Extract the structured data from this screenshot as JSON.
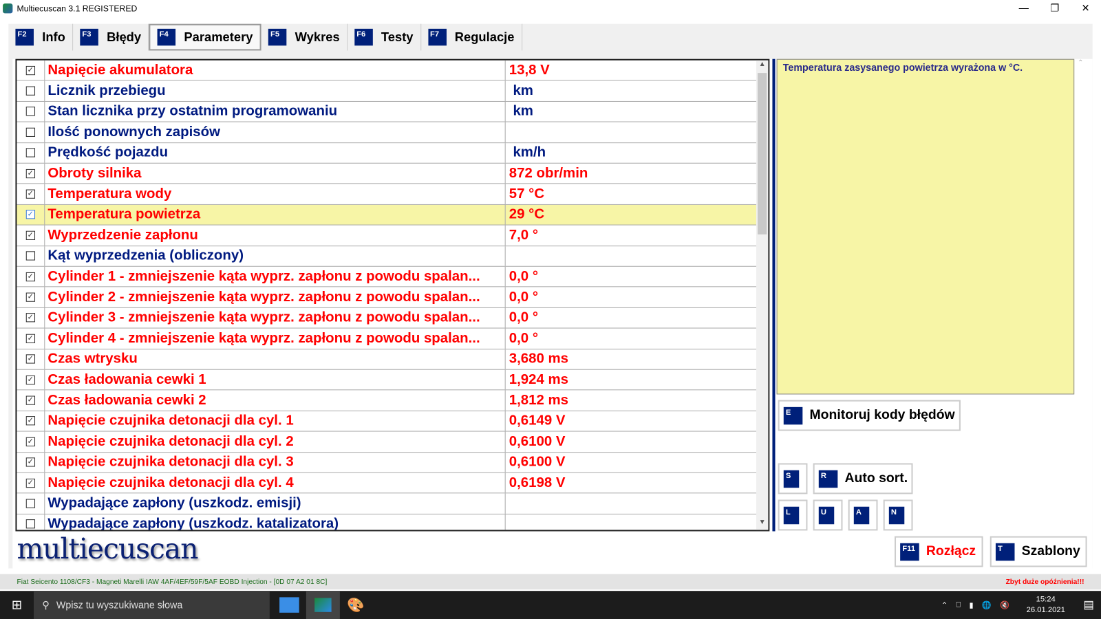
{
  "window": {
    "title": "Multiecuscan 3.1 REGISTERED"
  },
  "tabs": [
    {
      "key": "F2",
      "label": "Info"
    },
    {
      "key": "F3",
      "label": "Błędy"
    },
    {
      "key": "F4",
      "label": "Parametery"
    },
    {
      "key": "F5",
      "label": "Wykres"
    },
    {
      "key": "F6",
      "label": "Testy"
    },
    {
      "key": "F7",
      "label": "Regulacje"
    }
  ],
  "params": [
    {
      "checked": true,
      "name": "Napięcie akumulatora",
      "value": "13,8 V"
    },
    {
      "checked": false,
      "name": "Licznik przebiegu",
      "value": " km"
    },
    {
      "checked": false,
      "name": "Stan licznika przy ostatnim programowaniu",
      "value": " km"
    },
    {
      "checked": false,
      "name": "Ilość ponownych zapisów",
      "value": ""
    },
    {
      "checked": false,
      "name": "Prędkość pojazdu",
      "value": " km/h"
    },
    {
      "checked": true,
      "name": "Obroty silnika",
      "value": "872 obr/min"
    },
    {
      "checked": true,
      "name": "Temperatura wody",
      "value": "57 °C"
    },
    {
      "checked": true,
      "name": "Temperatura powietrza",
      "value": "29 °C",
      "selected": true
    },
    {
      "checked": true,
      "name": "Wyprzedzenie zapłonu",
      "value": "7,0 °"
    },
    {
      "checked": false,
      "name": "Kąt wyprzedzenia (obliczony)",
      "value": ""
    },
    {
      "checked": true,
      "name": "Cylinder 1 - zmniejszenie kąta wyprz. zapłonu z powodu spalan...",
      "value": "0,0 °"
    },
    {
      "checked": true,
      "name": "Cylinder 2 - zmniejszenie kąta wyprz. zapłonu z powodu spalan...",
      "value": "0,0 °"
    },
    {
      "checked": true,
      "name": "Cylinder 3 - zmniejszenie kąta wyprz. zapłonu z powodu spalan...",
      "value": "0,0 °"
    },
    {
      "checked": true,
      "name": "Cylinder 4 - zmniejszenie kąta wyprz. zapłonu z powodu spalan...",
      "value": "0,0 °"
    },
    {
      "checked": true,
      "name": "Czas wtrysku",
      "value": "3,680 ms"
    },
    {
      "checked": true,
      "name": "Czas ładowania cewki 1",
      "value": "1,924 ms"
    },
    {
      "checked": true,
      "name": "Czas ładowania cewki 2",
      "value": "1,812 ms"
    },
    {
      "checked": true,
      "name": "Napięcie czujnika detonacji dla cyl. 1",
      "value": "0,6149 V"
    },
    {
      "checked": true,
      "name": "Napięcie czujnika detonacji dla cyl. 2",
      "value": "0,6100 V"
    },
    {
      "checked": true,
      "name": "Napięcie czujnika detonacji dla cyl. 3",
      "value": "0,6100 V"
    },
    {
      "checked": true,
      "name": "Napięcie czujnika detonacji dla cyl. 4",
      "value": "0,6198 V"
    },
    {
      "checked": false,
      "name": "Wypadające zapłony (uszkodz. emisji)",
      "value": ""
    },
    {
      "checked": false,
      "name": "Wypadające zapłony (uszkodz. katalizatora)",
      "value": ""
    }
  ],
  "info_text": "Temperatura zasysanego powietrza wyrażona w °C.",
  "buttons": {
    "monitor": {
      "key": "E",
      "label": "Monitoruj kody błędów"
    },
    "s": {
      "key": "S"
    },
    "autosort": {
      "key": "R",
      "label": "Auto sort."
    },
    "l": {
      "key": "L"
    },
    "u": {
      "key": "U"
    },
    "a": {
      "key": "A"
    },
    "n": {
      "key": "N"
    },
    "disconnect": {
      "key": "F11",
      "label": "Rozłącz"
    },
    "templates": {
      "key": "T",
      "label": "Szablony"
    }
  },
  "logo": "multiecuscan",
  "status": {
    "vehicle": "Fiat Seicento 1108/CF3 - Magneti Marelli IAW 4AF/4EF/59F/5AF EOBD Injection - [0D 07 A2 01 8C]",
    "warning": "Zbyt duże opóźnienia!!!"
  },
  "taskbar": {
    "search_placeholder": "Wpisz tu wyszukiwane słowa",
    "time": "15:24",
    "date": "26.01.2021"
  },
  "colors": {
    "accent": "#00207a",
    "active_param": "#ff0000",
    "inactive_param": "#001a80",
    "highlight": "#f7f5a6"
  }
}
